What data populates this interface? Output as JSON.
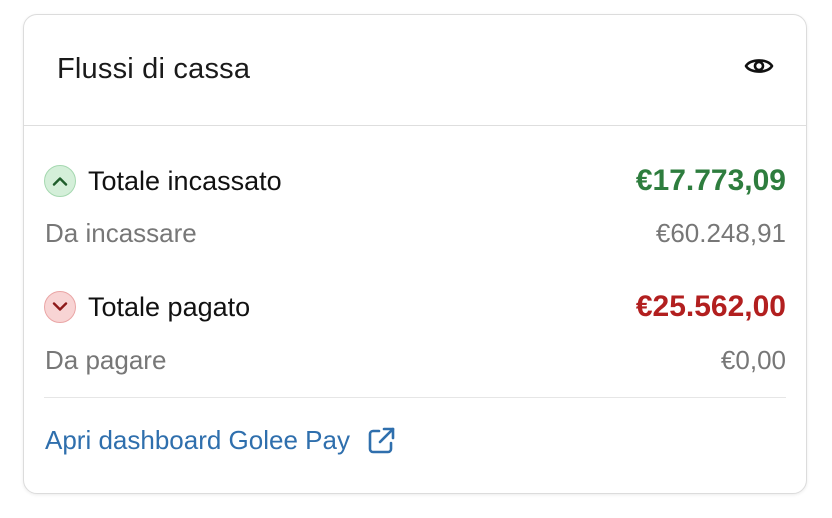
{
  "card": {
    "title": "Flussi di cassa",
    "visibility_icon": "eye-icon"
  },
  "incoming": {
    "label": "Totale incassato",
    "value": "€17.773,09",
    "value_color": "#2e7d3e",
    "icon": "chevron-up-icon",
    "pending_label": "Da incassare",
    "pending_value": "€60.248,91"
  },
  "outgoing": {
    "label": "Totale pagato",
    "value": "€25.562,00",
    "value_color": "#b21f1f",
    "icon": "chevron-down-icon",
    "pending_label": "Da pagare",
    "pending_value": "€0,00"
  },
  "footer": {
    "link_label": "Apri dashboard Golee Pay",
    "link_icon": "external-link-icon",
    "link_color": "#2f6fad"
  }
}
